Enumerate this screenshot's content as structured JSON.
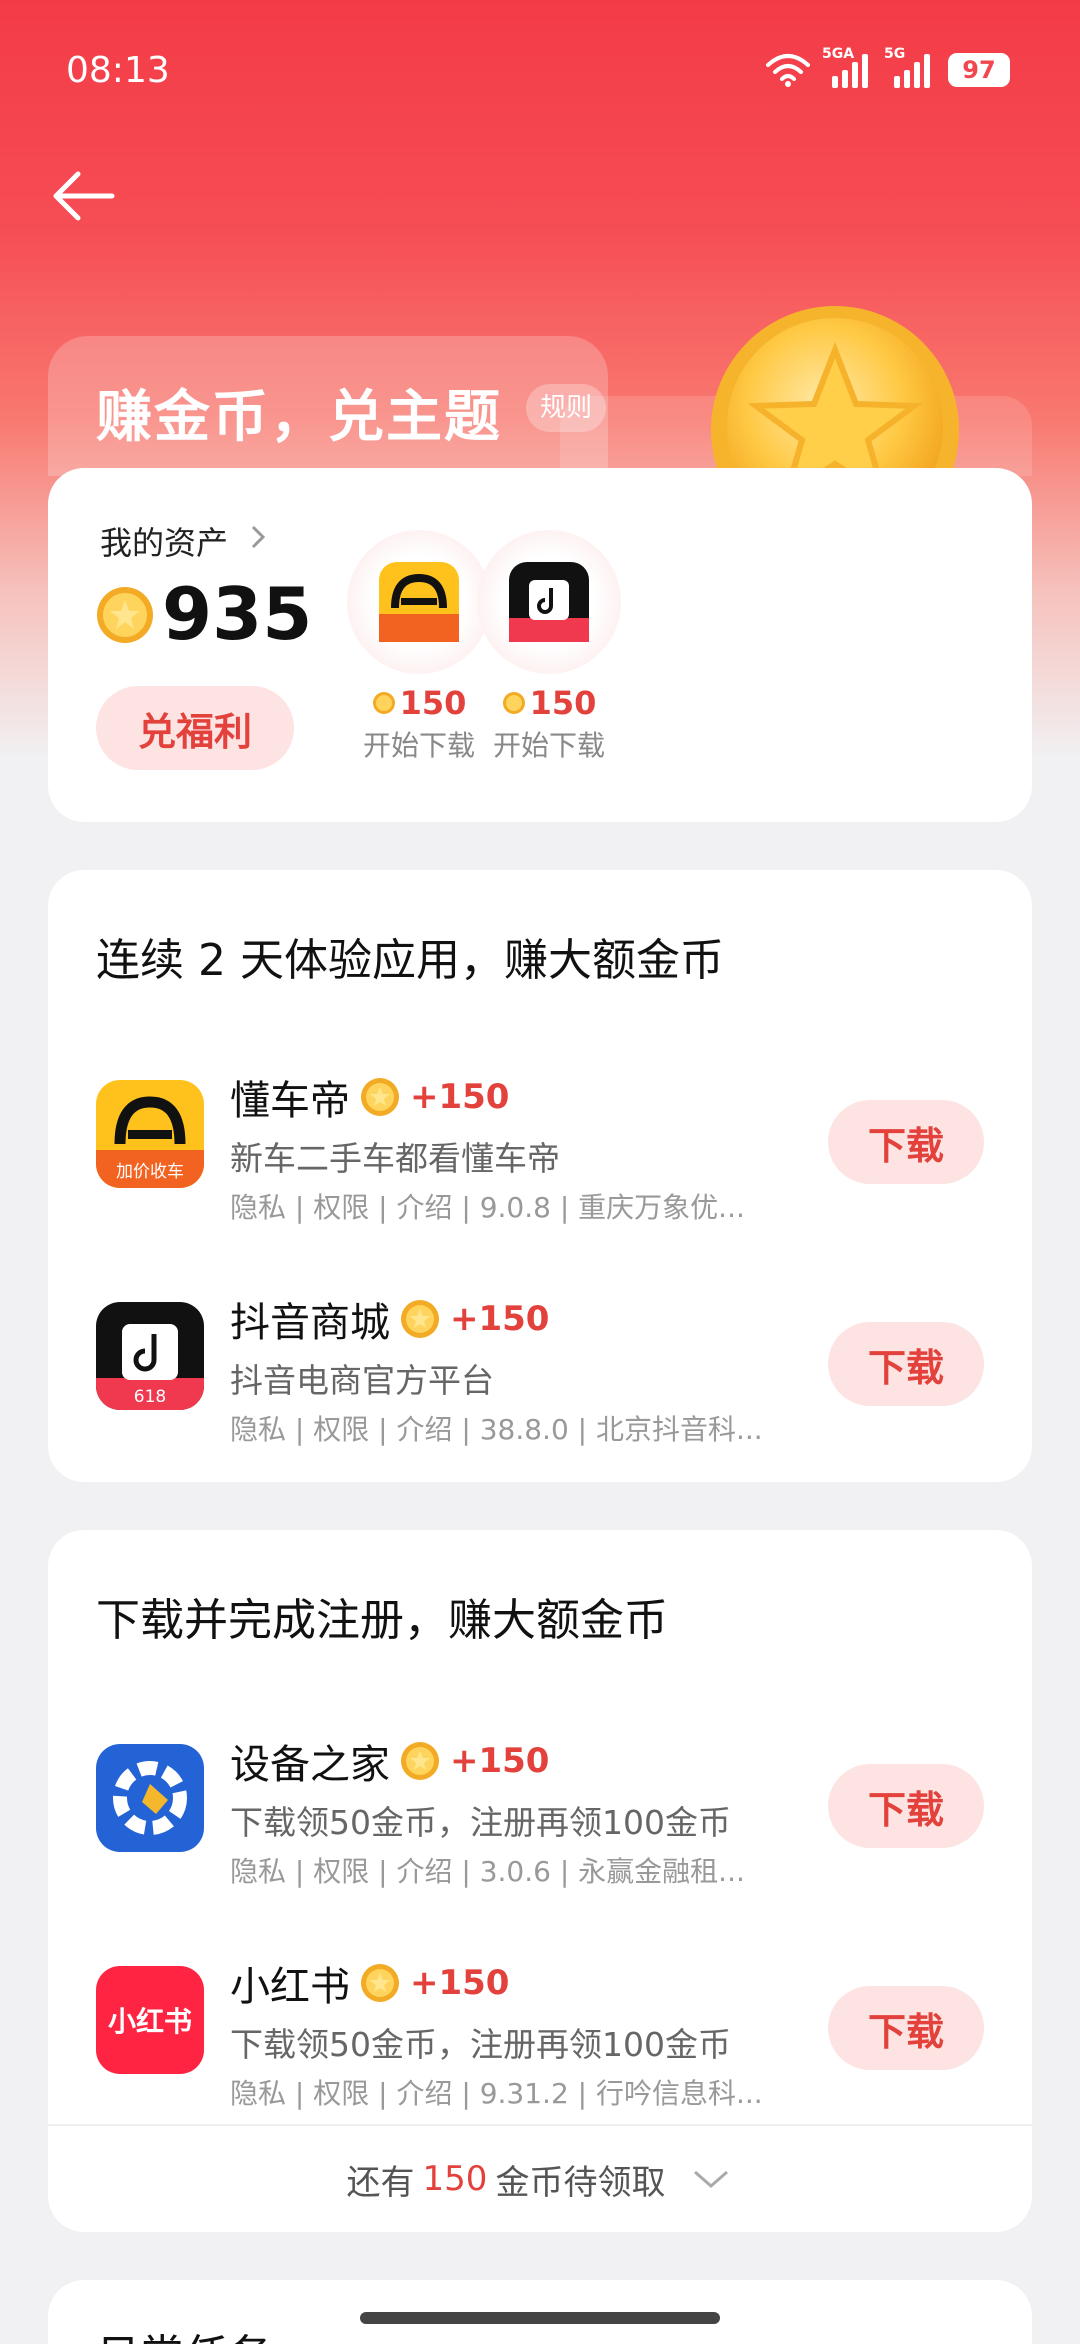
{
  "status_bar": {
    "time": "08:13",
    "signal1_tag": "5GA",
    "signal2_tag": "5G",
    "battery": "97"
  },
  "header": {
    "title": "赚金币，兑主题",
    "rules": "规则"
  },
  "assets": {
    "label": "我的资产",
    "value": "935",
    "redeem_label": "兑福利",
    "apps": [
      {
        "reward": "150",
        "action": "开始下载"
      },
      {
        "reward": "150",
        "action": "开始下载"
      }
    ]
  },
  "section1": {
    "title": "连续 2 天体验应用，赚大额金币",
    "apps": [
      {
        "name": "懂车帝",
        "reward": "+150",
        "desc": "新车二手车都看懂车帝",
        "meta": "隐私 | 权限 | 介绍 | 9.0.8 | 重庆万象优...",
        "action": "下载",
        "icon_badge": "加价收车"
      },
      {
        "name": "抖音商城",
        "reward": "+150",
        "desc": "抖音电商官方平台",
        "meta": "隐私 | 权限 | 介绍 | 38.8.0 | 北京抖音科...",
        "action": "下载",
        "icon_badge": "618"
      }
    ]
  },
  "section2": {
    "title": "下载并完成注册，赚大额金币",
    "apps": [
      {
        "name": "设备之家",
        "reward": "+150",
        "desc": "下载领50金币，注册再领100金币",
        "meta": "隐私 | 权限 | 介绍 | 3.0.6 | 永赢金融租...",
        "action": "下载"
      },
      {
        "name": "小红书",
        "reward": "+150",
        "desc": "下载领50金币，注册再领100金币",
        "meta": "隐私 | 权限 | 介绍 | 9.31.2 | 行吟信息科...",
        "action": "下载",
        "icon_text": "小红书"
      }
    ],
    "pending_prefix": "还有",
    "pending_amount": "150",
    "pending_suffix": "金币待领取"
  },
  "daily": {
    "title": "日常任务"
  },
  "colors": {
    "accent": "#e3423c",
    "hero_top": "#f33b47",
    "button_bg": "#fde4e3"
  }
}
